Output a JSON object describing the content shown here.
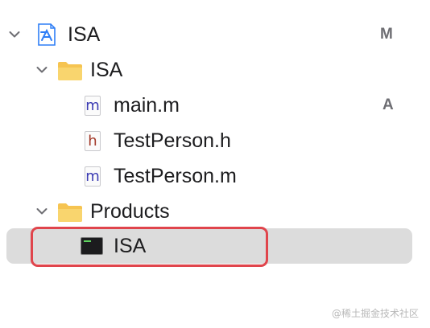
{
  "navigator": {
    "items": [
      {
        "label": "ISA",
        "status": "M",
        "icon": "xcode-project-icon",
        "expanded": true
      },
      {
        "label": "ISA",
        "status": "",
        "icon": "folder-icon",
        "expanded": true
      },
      {
        "label": "main.m",
        "status": "A",
        "icon": "objc-implementation-file-icon",
        "icon_glyph": "m"
      },
      {
        "label": "TestPerson.h",
        "status": "",
        "icon": "header-file-icon",
        "icon_glyph": "h"
      },
      {
        "label": "TestPerson.m",
        "status": "",
        "icon": "objc-implementation-file-icon",
        "icon_glyph": "m"
      },
      {
        "label": "Products",
        "status": "",
        "icon": "folder-icon",
        "expanded": true
      },
      {
        "label": "ISA",
        "status": "",
        "icon": "executable-icon",
        "selected": true
      }
    ]
  },
  "colors": {
    "selection": "#dcdcdc",
    "highlight_border": "#e0454c",
    "folder": "#f6c451",
    "project_blue": "#2f7ef6"
  },
  "watermark": "@稀土掘金技术社区"
}
